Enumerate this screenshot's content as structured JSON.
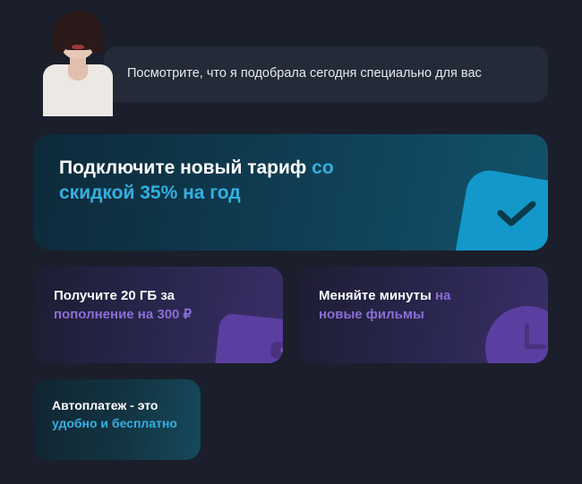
{
  "assistant": {
    "message": "Посмотрите, что я подобрала сегодня специально для вас"
  },
  "promo_main": {
    "text_plain": "Подключите новый тариф ",
    "text_accent": "со скидкой 35% на год"
  },
  "cards": [
    {
      "text_plain": "Получите 20 ГБ за ",
      "text_accent": "пополнение на 300 ₽",
      "icon": "wallet-icon"
    },
    {
      "text_plain": "Меняйте минуты ",
      "text_accent": "на новые фильмы",
      "icon": "clock-icon"
    },
    {
      "text_plain": "Автоплатеж - это ",
      "text_accent": "удобно и бесплатно",
      "icon": null
    }
  ],
  "colors": {
    "bg": "#1a1f2b",
    "accent_blue": "#34b0e2",
    "accent_purple": "#8b6ed6"
  }
}
